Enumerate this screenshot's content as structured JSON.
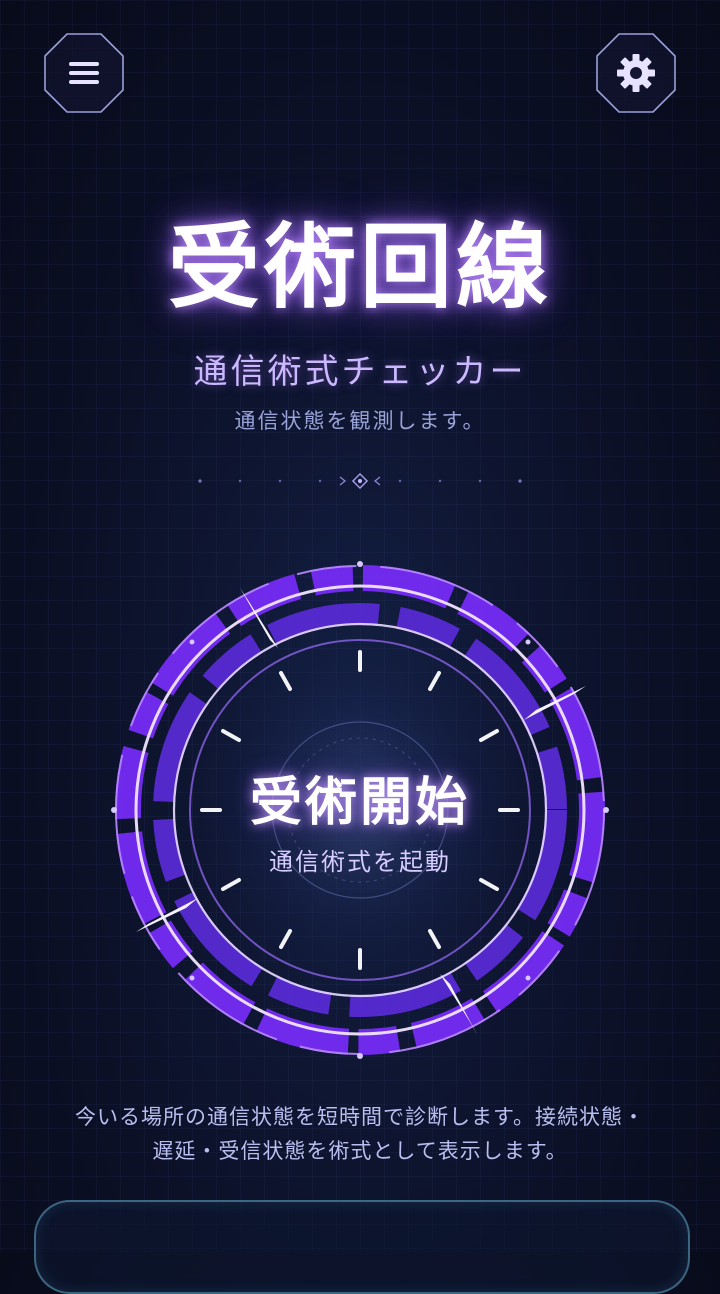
{
  "header": {
    "menu_icon": "hamburger-menu-icon",
    "settings_icon": "gear-icon"
  },
  "hero": {
    "title": "受術回線",
    "subtitle": "通信術式チェッカー",
    "caption": "通信状態を観測します。"
  },
  "start_button": {
    "label": "受術開始",
    "sublabel": "通信術式を起動"
  },
  "description": {
    "line1": "今いる場所の通信状態を短時間で診断します。接続状態・",
    "line2": "遅延・受信状態を術式として表示します。"
  },
  "colors": {
    "accent_purple": "#8a3cff",
    "glow_violet": "#c08cff",
    "ring_white": "#f4eaff",
    "panel_border": "#64aac8",
    "background": "#0a0e22"
  }
}
